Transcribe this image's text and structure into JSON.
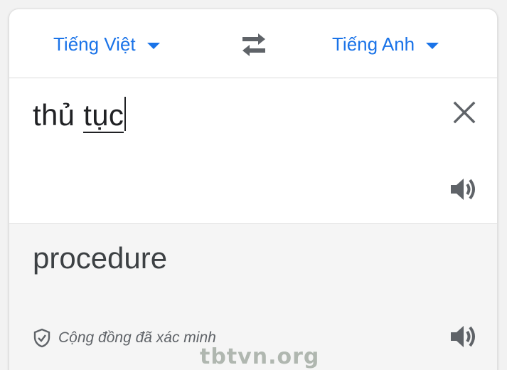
{
  "languages": {
    "source": "Tiếng Việt",
    "target": "Tiếng Anh"
  },
  "input": {
    "text_before": "thủ ",
    "text_underlined": "tục"
  },
  "output": {
    "translation": "procedure",
    "verified_label": "Cộng đồng đã xác minh"
  },
  "icons": {
    "swap": "swap-arrows-icon",
    "clear": "close-icon",
    "speaker": "speaker-icon",
    "verified": "shield-check-icon"
  },
  "colors": {
    "accent": "#1a73e8",
    "text": "#202124",
    "secondary": "#5f6368"
  },
  "watermark": "tbtvn.org"
}
